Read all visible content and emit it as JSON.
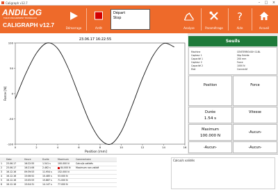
{
  "window": {
    "title": "Caligraph v12.7"
  },
  "header": {
    "logo_brand": "ANDILOG",
    "logo_tagline": "FORCE MEASUREMENT TECHNOLOGY",
    "product": "CALIGRAPH v12.7",
    "buttons": [
      {
        "label": "Démarrage",
        "icon": "play-icon"
      },
      {
        "label": "Arrêt",
        "icon": "stop-icon"
      },
      {
        "label": "Analyse",
        "icon": "chart-icon"
      },
      {
        "label": "Paramétrage",
        "icon": "tools-icon"
      },
      {
        "label": "Aide",
        "icon": "help-icon"
      },
      {
        "label": "Accueil",
        "icon": "home-icon"
      }
    ],
    "status": {
      "line1": "Départ",
      "line2": "Stop"
    },
    "colors": {
      "accent": "#ee6a2a",
      "stop_red": "#d40000"
    }
  },
  "chart_data": {
    "type": "line",
    "title": "23.06.17 16:22:55",
    "xlabel": "Position [mm]",
    "ylabel": "Force [N]",
    "xlim": [
      0,
      16
    ],
    "ylim": [
      -100,
      100
    ],
    "xticks": [
      "0",
      "2",
      "4",
      "6",
      "8",
      "10",
      "12",
      "14",
      "16"
    ],
    "yticks": [
      "100",
      "50",
      "0",
      "-50",
      "-100"
    ],
    "series": [
      {
        "color": "#111111",
        "x": [
          0,
          1,
          2,
          3,
          4,
          5,
          6,
          7,
          8,
          9,
          10,
          11,
          12,
          13,
          14,
          15
        ],
        "y": [
          -10,
          40,
          80,
          100,
          89,
          50,
          -3,
          -55,
          -90,
          -100,
          -75,
          -25,
          30,
          75,
          99,
          92
        ]
      }
    ]
  },
  "right_panel": {
    "seuils_label": "Seuils",
    "info": [
      {
        "k": "Machine",
        "v": "CENTERROUGH CLBL"
      },
      {
        "k": "Capteur 1",
        "v": "Stip Entrée"
      },
      {
        "k": "Capacité 1",
        "v": "200 mm"
      },
      {
        "k": "Capteur 2",
        "v": "Force"
      },
      {
        "k": "Capacité 2",
        "v": "1000 N"
      },
      {
        "k": "Etat",
        "v": "Connecté"
      }
    ],
    "cells": {
      "position": "Position",
      "force": "Force",
      "duree_label": "Durée",
      "duree_value": "1.54 s",
      "vitesse_label": "Vitesse",
      "vitesse_value": "",
      "maximum_label": "Maximum",
      "maximum_value": "100.000 N",
      "aucun1": "-Aucun-",
      "aucun2": "-Aucun-",
      "aucun3": "-Aucun-"
    }
  },
  "log_table": {
    "headers": [
      "",
      "Date",
      "Heure",
      "Durée",
      "Maximum",
      "Commentaire"
    ],
    "rows": [
      {
        "n": "1",
        "date": "23.06.17",
        "heure": "16:22:55",
        "duree": "1.541 s",
        "max": "100.000 N",
        "comment": "Calcul/s validés",
        "flag": false
      },
      {
        "n": "2",
        "date": "23.06.17",
        "heure": "16:21:06",
        "duree": "2.462 s",
        "max": "84.000 N",
        "comment": "Maximum non validé",
        "flag": true
      },
      {
        "n": "3",
        "date": "16.12.16",
        "heure": "09:39:53",
        "duree": "11.954 s",
        "max": "152.000 N",
        "comment": "",
        "flag": false
      },
      {
        "n": "4",
        "date": "16.12.16",
        "heure": "15:06:52",
        "duree": "10.485 s",
        "max": "53.000 N",
        "comment": "",
        "flag": false
      },
      {
        "n": "5",
        "date": "16.12.16",
        "heure": "15:05:53",
        "duree": "15.887 s",
        "max": "71.000 N",
        "comment": "",
        "flag": false
      },
      {
        "n": "6",
        "date": "16.12.16",
        "heure": "15:04:31",
        "duree": "14.147 s",
        "max": "77.000 N",
        "comment": "",
        "flag": false
      }
    ]
  },
  "message": "Calcul/s validés"
}
